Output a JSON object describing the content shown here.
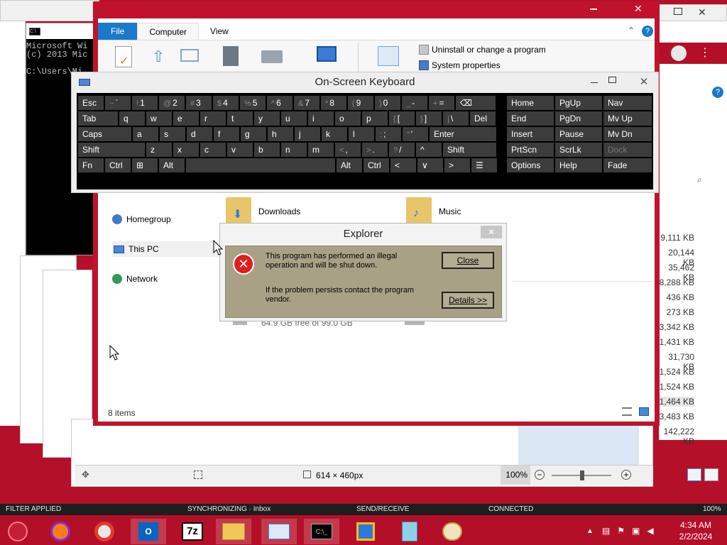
{
  "cmd": {
    "lines": [
      "Microsoft Wi",
      "(c) 2013 Mic",
      "",
      "C:\\Users\\Mi"
    ]
  },
  "explorer": {
    "tabs": [
      {
        "label": "File"
      },
      {
        "label": "Computer"
      },
      {
        "label": "View"
      }
    ],
    "ribbon_links": {
      "uninstall": "Uninstall or change a program",
      "system_properties": "System properties"
    },
    "nav": {
      "homegroup": "Homegroup",
      "this_pc": "This PC",
      "network": "Network"
    },
    "folders": {
      "downloads": "Downloads",
      "music": "Music"
    },
    "drive_free": "64.9 GB free of 99.0 GB",
    "item_count": "8 items"
  },
  "osk": {
    "title": "On-Screen Keyboard",
    "rows": [
      [
        {
          "l": "Esc",
          "w": 38
        },
        {
          "s": "~",
          "l": "`",
          "w": 38
        },
        {
          "s": "!",
          "l": "1",
          "w": 38
        },
        {
          "s": "@",
          "l": "2",
          "w": 38
        },
        {
          "s": "#",
          "l": "3",
          "w": 38
        },
        {
          "s": "$",
          "l": "4",
          "w": 38
        },
        {
          "s": "%",
          "l": "5",
          "w": 38
        },
        {
          "s": "^",
          "l": "6",
          "w": 38
        },
        {
          "s": "&",
          "l": "7",
          "w": 38
        },
        {
          "s": "*",
          "l": "8",
          "w": 38
        },
        {
          "s": "(",
          "l": "9",
          "w": 38
        },
        {
          "s": ")",
          "l": "0",
          "w": 38
        },
        {
          "s": "_",
          "l": "-",
          "w": 38
        },
        {
          "s": "+",
          "l": "=",
          "w": 38
        },
        {
          "l": "⌫",
          "w": 58
        }
      ],
      [
        {
          "l": "Tab",
          "w": 58
        },
        {
          "l": "q",
          "w": 38
        },
        {
          "l": "w",
          "w": 38
        },
        {
          "l": "e",
          "w": 38
        },
        {
          "l": "r",
          "w": 38
        },
        {
          "l": "t",
          "w": 38
        },
        {
          "l": "y",
          "w": 38
        },
        {
          "l": "u",
          "w": 38
        },
        {
          "l": "i",
          "w": 38
        },
        {
          "l": "o",
          "w": 38
        },
        {
          "l": "p",
          "w": 38
        },
        {
          "s": "{",
          "l": "[",
          "w": 38
        },
        {
          "s": "}",
          "l": "]",
          "w": 38
        },
        {
          "s": "|",
          "l": "\\",
          "w": 38
        },
        {
          "l": "Del",
          "w": 38
        }
      ],
      [
        {
          "l": "Caps",
          "w": 77
        },
        {
          "l": "a",
          "w": 38
        },
        {
          "l": "s",
          "w": 38
        },
        {
          "l": "d",
          "w": 38
        },
        {
          "l": "f",
          "w": 38
        },
        {
          "l": "g",
          "w": 38
        },
        {
          "l": "h",
          "w": 38
        },
        {
          "l": "j",
          "w": 38
        },
        {
          "l": "k",
          "w": 38
        },
        {
          "l": "l",
          "w": 38
        },
        {
          "s": ":",
          "l": ";",
          "w": 38
        },
        {
          "s": "\"",
          "l": "'",
          "w": 38
        },
        {
          "l": "Enter",
          "w": 96
        }
      ],
      [
        {
          "l": "Shift",
          "w": 96
        },
        {
          "l": "z",
          "w": 38
        },
        {
          "l": "x",
          "w": 38
        },
        {
          "l": "c",
          "w": 38
        },
        {
          "l": "v",
          "w": 38
        },
        {
          "l": "b",
          "w": 38
        },
        {
          "l": "n",
          "w": 38
        },
        {
          "l": "m",
          "w": 38
        },
        {
          "s": "<",
          "l": ",",
          "w": 38
        },
        {
          "s": ">",
          "l": ".",
          "w": 38
        },
        {
          "s": "?",
          "l": "/",
          "w": 38
        },
        {
          "l": "^",
          "w": 38
        },
        {
          "l": "Shift",
          "w": 77
        }
      ],
      [
        {
          "l": "Fn",
          "w": 38
        },
        {
          "l": "Ctrl",
          "w": 38
        },
        {
          "l": "⊞",
          "w": 38
        },
        {
          "l": "Alt",
          "w": 38
        },
        {
          "l": "",
          "w": 212
        },
        {
          "l": "Alt",
          "w": 38
        },
        {
          "l": "Ctrl",
          "w": 38
        },
        {
          "l": "<",
          "w": 38
        },
        {
          "l": "∨",
          "w": 38
        },
        {
          "l": ">",
          "w": 38
        },
        {
          "l": "☰",
          "w": 38
        }
      ]
    ],
    "nav_keys": [
      [
        "Home",
        "PgUp",
        "Nav"
      ],
      [
        "End",
        "PgDn",
        "Mv Up"
      ],
      [
        "Insert",
        "Pause",
        "Mv Dn"
      ],
      [
        "PrtScn",
        "ScrLk",
        "Dock"
      ],
      [
        "Options",
        "Help",
        "Fade"
      ]
    ]
  },
  "dialog": {
    "title": "Explorer",
    "message1": "This program has performed an illegal operation and will be shut down.",
    "message2": "If the problem persists contact the program vendor.",
    "close_label": "Close",
    "details_label": "Details >>"
  },
  "viewer": {
    "dimensions": "614 × 460px",
    "zoom": "100%"
  },
  "outlook_status": {
    "filter": "FILTER APPLIED",
    "sync": "SYNCHRONIZING · Inbox",
    "send": "SEND/RECEIVE",
    "conn": "CONNECTED",
    "pct": "100%"
  },
  "sizes": [
    "9,111 KB",
    "20,144 KB",
    "35,462 KB",
    "8,288 KB",
    "436 KB",
    "273 KB",
    "3,342 KB",
    "1,431 KB",
    "31,730 KB",
    "1,524 KB",
    "1,524 KB",
    "1,464 KB",
    "3,483 KB",
    "142,222 KB"
  ],
  "clock": {
    "time": "4:34 AM",
    "date": "2/2/2024"
  },
  "colors": {
    "accent": "#1979ca",
    "frame": "#c0122c",
    "dialog_bg": "#a8a185"
  }
}
